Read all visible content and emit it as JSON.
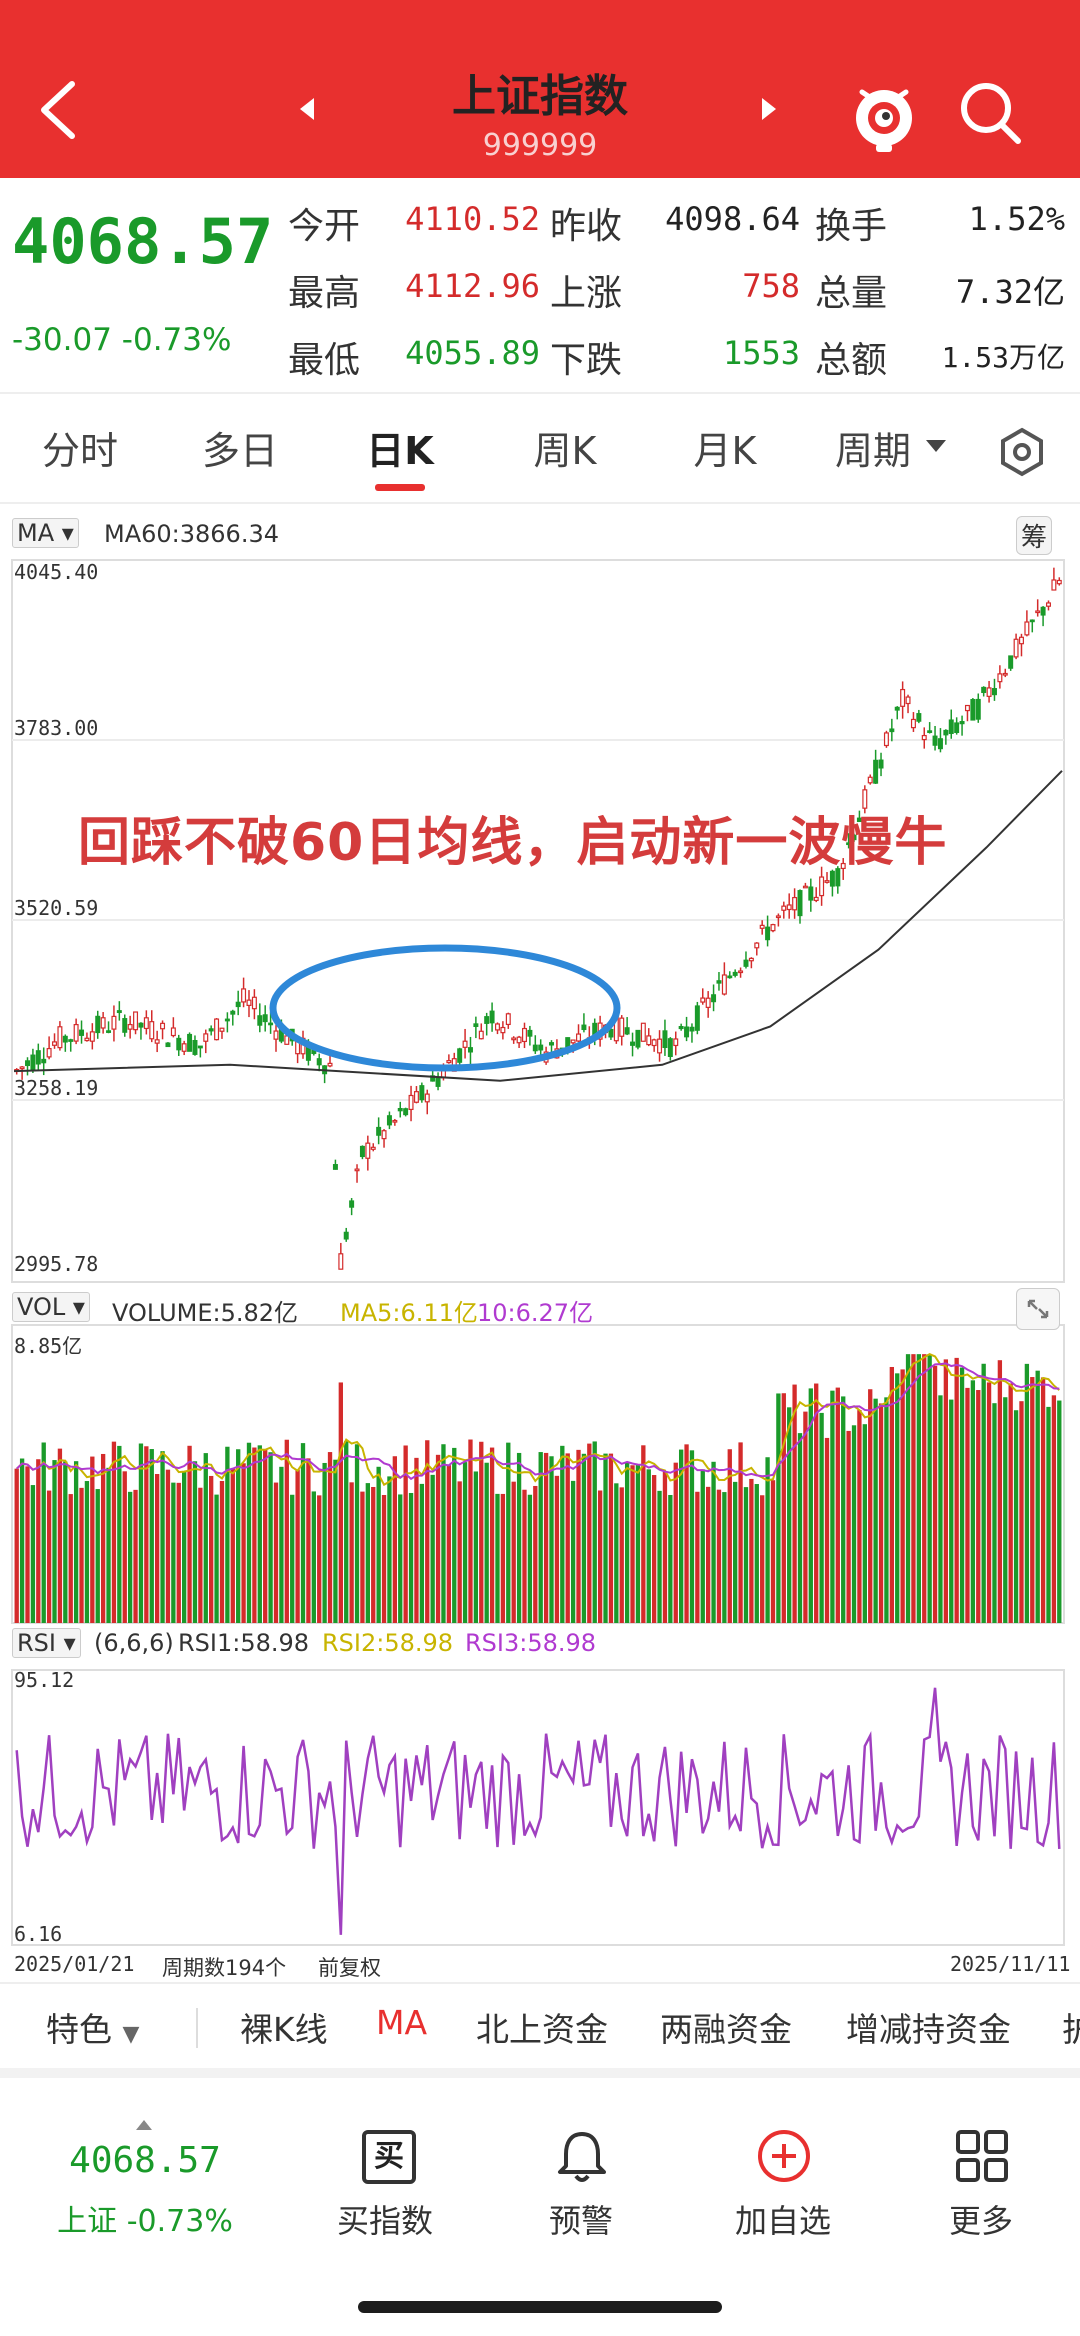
{
  "header": {
    "title": "上证指数",
    "code": "999999"
  },
  "quote": {
    "price": "4068.57",
    "change": "-30.07 -0.73%",
    "rows": [
      {
        "l1": "今开",
        "v1": "4110.52",
        "c1": "red",
        "l2": "昨收",
        "v2": "4098.64",
        "c2": "black",
        "l3": "换手",
        "v3": "1.52%"
      },
      {
        "l1": "最高",
        "v1": "4112.96",
        "c1": "red",
        "l2": "上涨",
        "v2": "758",
        "c2": "red",
        "l3": "总量",
        "v3": "7.32亿"
      },
      {
        "l1": "最低",
        "v1": "4055.89",
        "c1": "green",
        "l2": "下跌",
        "v2": "1553",
        "c2": "green",
        "l3": "总额",
        "v3": "1.53万亿"
      }
    ]
  },
  "tabs": [
    "分时",
    "多日",
    "日K",
    "周K",
    "月K",
    "周期"
  ],
  "active_tab": 2,
  "colors": {
    "up": "#d42b2b",
    "down": "#1a9a2a",
    "accent": "#e8302f",
    "ma5": "#c8b400",
    "ma10": "#b03ad0",
    "annotation": "#d43c3c",
    "ellipse": "#2e88d8"
  },
  "icons": [
    "back-arrow-icon",
    "mascot-icon",
    "search-icon",
    "settings-hexagon-icon",
    "expand-icon",
    "buy-index-icon",
    "bell-icon",
    "add-circle-icon",
    "grid-icon"
  ],
  "kline_panel": {
    "indicator": "MA",
    "ma_label": "MA60:3866.34",
    "chip_right": "筹",
    "y_ticks": [
      "4045.40",
      "3783.00",
      "3520.59",
      "3258.19",
      "2995.78"
    ],
    "annotation": "回踩不破60日均线，启动新一波慢牛"
  },
  "volume_panel": {
    "indicator": "VOL",
    "vol_text": "VOLUME:5.82亿",
    "ma5_text": "MA5:6.11亿",
    "ma10_text": "10:6.27亿",
    "y_top": "8.85亿"
  },
  "rsi_panel": {
    "indicator": "RSI",
    "params": "(6,6,6)",
    "rsi1": "RSI1:58.98",
    "rsi2": "RSI2:58.98",
    "rsi3": "RSI3:58.98",
    "y_top": "95.12",
    "y_bottom": "6.16"
  },
  "footer_axis": {
    "start": "2025/01/21",
    "count": "周期数194个",
    "adj": "前复权",
    "end": "2025/11/11"
  },
  "features": [
    "特色",
    "裸K线",
    "MA",
    "北上资金",
    "两融资金",
    "增减持资金",
    "护"
  ],
  "bottom_nav": {
    "price": "4068.57",
    "label": "上证 -0.73%",
    "items": [
      "买指数",
      "预警",
      "加自选",
      "更多"
    ],
    "buy_icon_char": "买"
  }
}
